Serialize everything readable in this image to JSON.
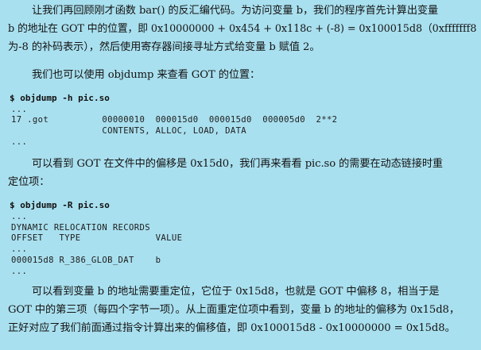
{
  "paragraph1": {
    "line1": "让我们再回顾刚才函数 bar() 的反汇编代码。为访问变量 b，我们的程序首先计算出变量",
    "line2": "b 的地址在 GOT 中的位置，即 0x10000000 + 0x454 + 0x118c + (-8) = 0x100015d8（0xfffffff8",
    "line3": "为-8 的补码表示），然后使用寄存器间接寻址方式给变量 b 赋值 2。"
  },
  "paragraph2": {
    "line1": "我们也可以使用 objdump 来查看 GOT 的位置："
  },
  "code1": {
    "command": "$ objdump -h pic.so",
    "line1": "...",
    "line2": "17 .got          00000010  000015d0  000015d0  000005d0  2**2",
    "line3": "                 CONTENTS, ALLOC, LOAD, DATA",
    "line4": "..."
  },
  "paragraph3": {
    "line1": "可以看到 GOT 在文件中的偏移是 0x15d0，我们再来看看 pic.so 的需要在动态链接时重",
    "line2": "定位项："
  },
  "code2": {
    "command": "$ objdump -R pic.so",
    "line1": "...",
    "line2": "DYNAMIC RELOCATION RECORDS",
    "line3": "OFFSET   TYPE              VALUE",
    "line4": "...",
    "line5": "000015d8 R_386_GLOB_DAT    b",
    "line6": "..."
  },
  "paragraph4": {
    "line1": "可以看到变量 b 的地址需要重定位，它位于 0x15d8，也就是 GOT 中偏移 8，相当于是",
    "line2": "GOT 中的第三项（每四个字节一项）。从上面重定位项中看到，变量 b 的地址的偏移为 0x15d8，",
    "line3": "正好对应了我们前面通过指令计算出来的偏移值，即 0x100015d8 - 0x10000000 = 0x15d8。"
  }
}
